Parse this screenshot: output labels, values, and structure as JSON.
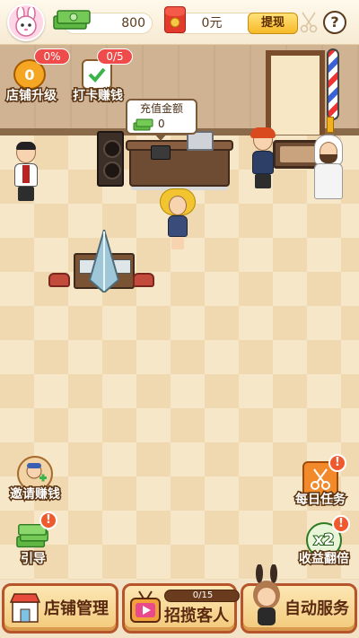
{
  "topbar": {
    "cash_value": "800",
    "rmb_value": "0元",
    "withdraw_label": "提现",
    "help_label": "?"
  },
  "scene": {
    "recharge": {
      "title": "充值金额",
      "value": "0"
    }
  },
  "left_menu": {
    "shop_upgrade": {
      "label": "店铺升级",
      "badge": "0%",
      "level": "0"
    },
    "checkin": {
      "label": "打卡赚钱",
      "badge": "0/5"
    },
    "invite": {
      "label": "邀请赚钱"
    },
    "guide": {
      "label": "引导"
    }
  },
  "right_menu": {
    "daily_tasks": {
      "label": "每日任务",
      "alert": "!"
    },
    "double_income": {
      "label": "收益翻倍",
      "multiplier": "x2",
      "alert": "!"
    }
  },
  "bottom_nav": {
    "shop_manage": {
      "label": "店铺管理"
    },
    "attract": {
      "label": "招揽客人",
      "progress_text": "0/15",
      "progress": 0
    },
    "auto_service": {
      "label": "自动服务"
    }
  },
  "colors": {
    "accent": "#f2b21b",
    "alert": "#f0582d",
    "nav_border": "#b6542b"
  },
  "icons": [
    "rabbit-avatar-icon",
    "cash-stack-icon",
    "red-packet-icon",
    "help-icon",
    "shop-icon",
    "tv-icon",
    "bunny-girl-icon",
    "scissors-icon"
  ]
}
